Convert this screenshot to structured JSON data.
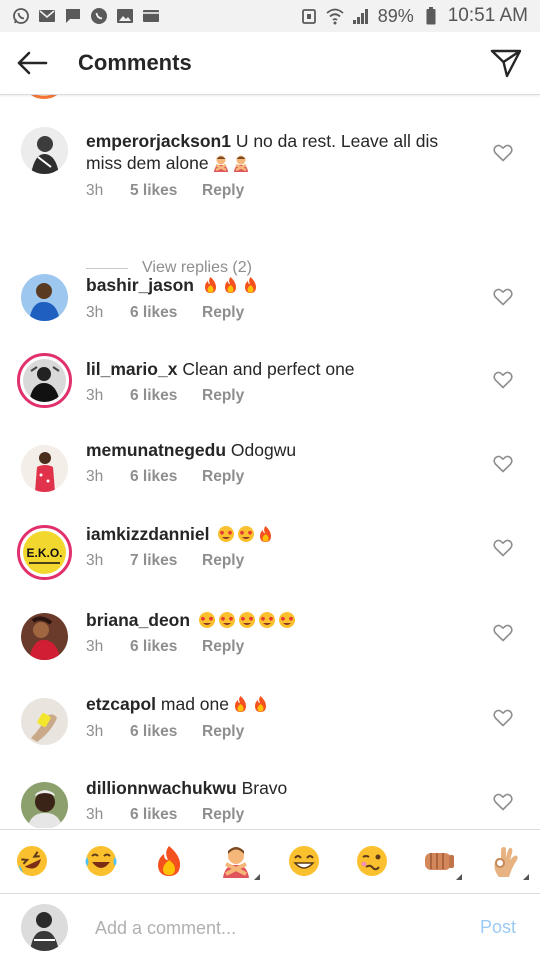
{
  "status_bar": {
    "left_icons": [
      "whatsapp-icon",
      "mail-icon",
      "message-icon",
      "whatsapp-icon",
      "image-icon",
      "mail-icon"
    ],
    "battery": "89%",
    "time": "10:51 AM"
  },
  "header": {
    "title": "Comments"
  },
  "comments": [
    {
      "username": "emperorjackson1",
      "text": "U no da rest. Leave all dis miss dem alone",
      "emojis": [
        "person-gesturing-no",
        "person-gesturing-no"
      ],
      "time": "3h",
      "likes": "5 likes",
      "reply": "Reply",
      "view_replies": "View replies (2)"
    },
    {
      "username": "bashir_jason",
      "text": "",
      "emojis": [
        "fire",
        "fire",
        "fire"
      ],
      "time": "3h",
      "likes": "6 likes",
      "reply": "Reply"
    },
    {
      "username": "lil_mario_x",
      "text": "Clean and perfect one",
      "emojis": [],
      "time": "3h",
      "likes": "6 likes",
      "reply": "Reply"
    },
    {
      "username": "memunatnegedu",
      "text": "Odogwu",
      "emojis": [],
      "time": "3h",
      "likes": "6 likes",
      "reply": "Reply"
    },
    {
      "username": "iamkizzdanniel",
      "text": "",
      "emojis": [
        "heart-eyes",
        "heart-eyes",
        "fire"
      ],
      "time": "3h",
      "likes": "7 likes",
      "reply": "Reply"
    },
    {
      "username": "briana_deon",
      "text": "",
      "emojis": [
        "heart-eyes",
        "heart-eyes",
        "heart-eyes",
        "heart-eyes",
        "heart-eyes"
      ],
      "time": "3h",
      "likes": "6 likes",
      "reply": "Reply"
    },
    {
      "username": "etzcapol",
      "text": "mad one",
      "emojis": [
        "fire",
        "fire"
      ],
      "time": "3h",
      "likes": "6 likes",
      "reply": "Reply"
    },
    {
      "username": "dillionnwachukwu",
      "text": "Bravo",
      "emojis": [],
      "time": "3h",
      "likes": "6 likes",
      "reply": "Reply"
    }
  ],
  "emoji_bar": [
    "rolling-laughing",
    "tears-of-joy",
    "fire",
    "person-gesturing-no",
    "grinning-smiling-eyes",
    "woozy-face",
    "fist-bump",
    "ok-hand"
  ],
  "input": {
    "placeholder": "Add a comment...",
    "post_label": "Post"
  },
  "colors": {
    "text": "#262626",
    "secondary": "#8e8e8e",
    "post_disabled": "#9ccaf5",
    "story_ring": "#e1306c"
  }
}
